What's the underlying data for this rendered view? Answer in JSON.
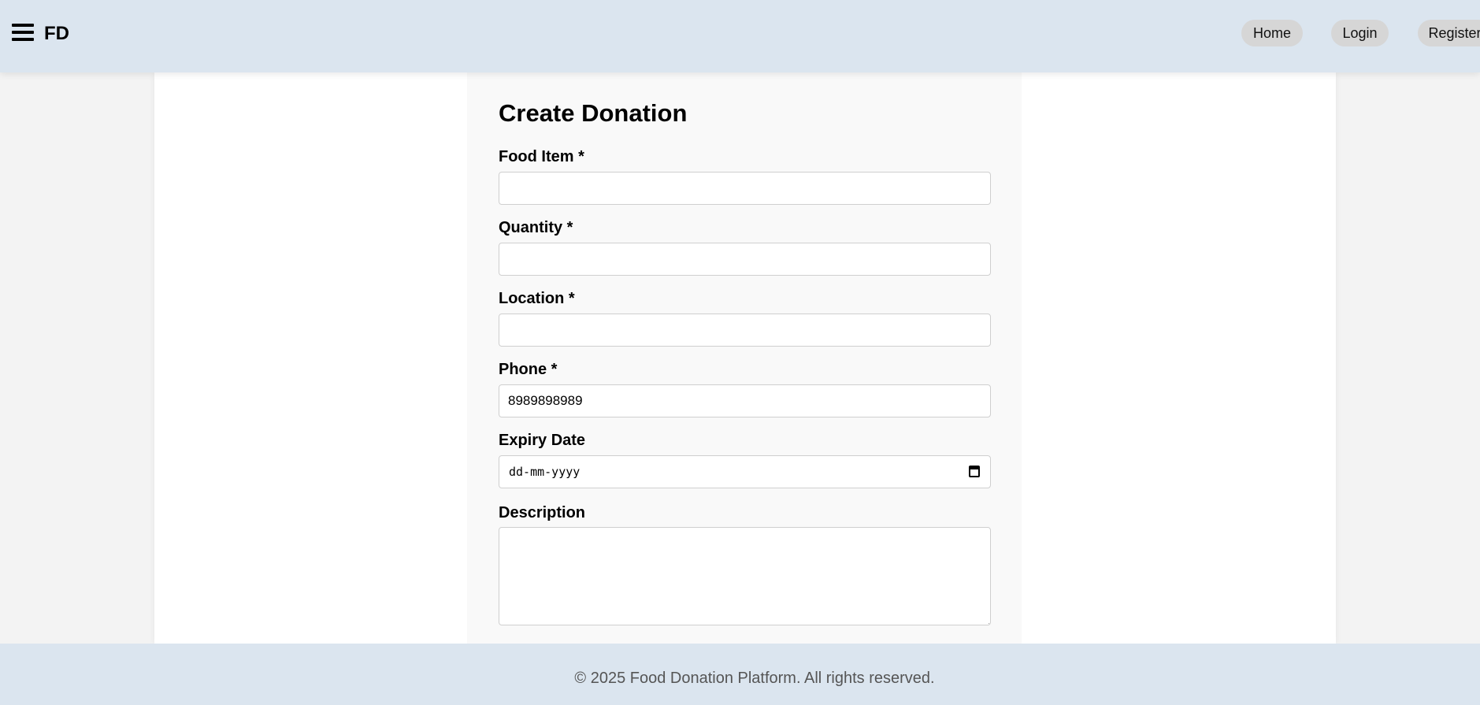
{
  "header": {
    "brand": "FD",
    "nav": {
      "home": "Home",
      "login": "Login",
      "register": "Register"
    }
  },
  "form": {
    "title": "Create Donation",
    "fields": {
      "food_item": {
        "label": "Food Item *",
        "value": ""
      },
      "quantity": {
        "label": "Quantity *",
        "value": ""
      },
      "location": {
        "label": "Location *",
        "value": ""
      },
      "phone": {
        "label": "Phone *",
        "value": "8989898989"
      },
      "expiry_date": {
        "label": "Expiry Date",
        "placeholder": "dd-mm-yyyy"
      },
      "description": {
        "label": "Description",
        "value": ""
      }
    }
  },
  "footer": {
    "text": "© 2025 Food Donation Platform. All rights reserved."
  },
  "colors": {
    "header_bg": "#dbe5ef",
    "page_bg": "#f3f3f3",
    "card_bg": "#f9f9f9",
    "nav_pill_bg": "#d6d6d6"
  },
  "icons": {
    "menu": "hamburger-menu-icon",
    "calendar": "calendar-icon"
  }
}
